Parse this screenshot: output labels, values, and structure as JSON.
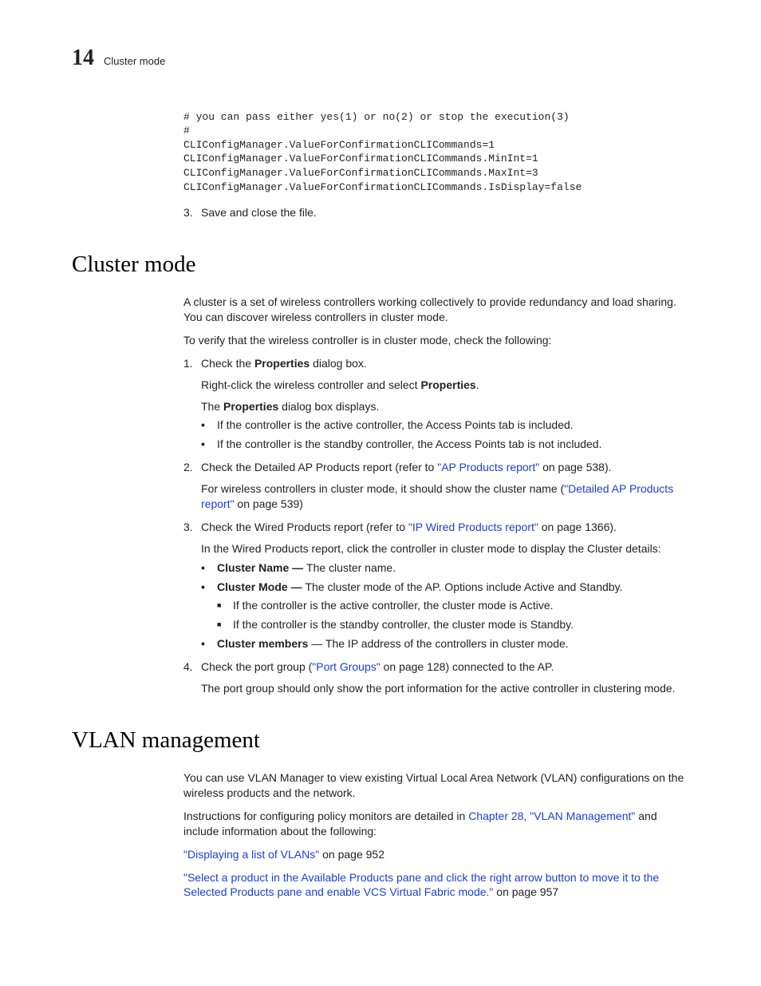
{
  "header": {
    "chapter_number": "14",
    "chapter_title": "Cluster mode"
  },
  "pre_section": {
    "code": "# you can pass either yes(1) or no(2) or stop the execution(3)\n#\nCLIConfigManager.ValueForConfirmationCLICommands=1\nCLIConfigManager.ValueForConfirmationCLICommands.MinInt=1\nCLIConfigManager.ValueForConfirmationCLICommands.MaxInt=3\nCLIConfigManager.ValueForConfirmationCLICommands.IsDisplay=false",
    "step3_num": "3.",
    "step3_text": "Save and close the file."
  },
  "cluster": {
    "heading": "Cluster mode",
    "intro": "A cluster is a set of wireless controllers working collectively to provide redundancy and load sharing. You can discover wireless controllers in cluster mode.",
    "verify": "To verify that the wireless controller is in cluster mode, check the following:",
    "s1_num": "1.",
    "s1_pre": "Check the ",
    "s1_bold": "Properties",
    "s1_post": " dialog box.",
    "s1_sub1_pre": "Right-click the wireless controller and select ",
    "s1_sub1_bold": "Properties",
    "s1_sub1_post": ".",
    "s1_sub2_pre": "The ",
    "s1_sub2_bold": "Properties",
    "s1_sub2_post": " dialog box displays.",
    "s1_b1": "If the controller is the active controller, the Access Points tab is included.",
    "s1_b2": "If the controller is the standby controller, the Access Points tab is not included.",
    "s2_num": "2.",
    "s2_pre": "Check the Detailed AP Products report (refer to ",
    "s2_link": "\"AP Products report\"",
    "s2_post": " on page 538).",
    "s2_sub_pre": "For wireless controllers in cluster mode, it should show the cluster name (",
    "s2_sub_link": "\"Detailed AP Products report\"",
    "s2_sub_post": " on page 539)",
    "s3_num": "3.",
    "s3_pre": "Check the Wired Products report (refer to ",
    "s3_link": "\"IP Wired Products report\"",
    "s3_post": " on page 1366).",
    "s3_sub": "In the Wired Products report, click the controller in cluster mode to display the Cluster details:",
    "s3_b1_bold": "Cluster Name — ",
    "s3_b1_text": "The cluster name.",
    "s3_b2_bold": "Cluster Mode — ",
    "s3_b2_text": "The cluster mode of the AP. Options include Active and Standby.",
    "s3_sq1": "If the controller is the active controller, the cluster mode is Active.",
    "s3_sq2": "If the controller is the standby controller, the cluster mode is Standby.",
    "s3_b3_bold": "Cluster members",
    "s3_b3_text": " — The IP address of the controllers in cluster mode.",
    "s4_num": "4.",
    "s4_pre": "Check the port group (",
    "s4_link": "\"Port Groups\"",
    "s4_post": " on page 128) connected to the AP.",
    "s4_sub": "The port group should only show the port information for the active controller in clustering mode."
  },
  "vlan": {
    "heading": "VLAN management",
    "p1": "You can use VLAN Manager to view existing Virtual Local Area Network (VLAN) configurations on the wireless products and the network.",
    "p2_pre": "Instructions for configuring policy monitors are detailed in ",
    "p2_link": "Chapter 28, \"VLAN Management\"",
    "p2_post": " and include information about the following:",
    "l1_link": "\"Displaying a list of VLANs\"",
    "l1_post": " on page 952",
    "l2_link": "\"Select a product in the Available Products pane and click the right arrow button to move it to the Selected Products pane and enable VCS Virtual Fabric mode.\"",
    "l2_post": " on page 957"
  }
}
